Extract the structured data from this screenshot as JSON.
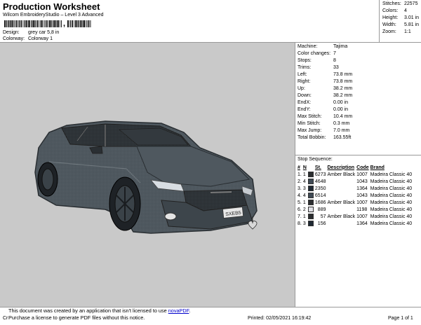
{
  "header": {
    "title": "Production Worksheet",
    "subtitle": "Wilcom EmbroideryStudio – Level 3 Advanced",
    "barcode_suffix": ","
  },
  "meta": [
    {
      "label": "Design:",
      "value": "grey car 5,8 in"
    },
    {
      "label": "Colorway:",
      "value": "Colorway 1"
    }
  ],
  "summary": [
    {
      "label": "Stitches:",
      "value": "22575"
    },
    {
      "label": "Colors:",
      "value": "4"
    },
    {
      "label": "Height:",
      "value": "3.01 in"
    },
    {
      "label": "Width:",
      "value": "5.81 in"
    },
    {
      "label": "Zoom:",
      "value": "1:1"
    }
  ],
  "stats": [
    {
      "label": "Machine:",
      "value": "Tajima"
    },
    {
      "label": "Color changes:",
      "value": "7"
    },
    {
      "label": "Stops:",
      "value": "8"
    },
    {
      "label": "Trims:",
      "value": "33"
    },
    {
      "label": "Left:",
      "value": "73.8 mm"
    },
    {
      "label": "Right:",
      "value": "73.8 mm"
    },
    {
      "label": "Up:",
      "value": "38.2 mm"
    },
    {
      "label": "Down:",
      "value": "38.2 mm"
    },
    {
      "label": "EndX:",
      "value": "0.00 in"
    },
    {
      "label": "EndY:",
      "value": "0.00 in"
    },
    {
      "label": "Max Stitch:",
      "value": "10.4 mm"
    },
    {
      "label": "Min Stitch:",
      "value": "0.3 mm"
    },
    {
      "label": "Max Jump:",
      "value": "7.0 mm"
    },
    {
      "label": "Total Bobbin:",
      "value": "163.55ft"
    }
  ],
  "sequence": {
    "title": "Stop Sequence:",
    "columns": [
      "#",
      "N",
      "",
      "St.",
      "Description",
      "Code",
      "Brand"
    ],
    "rows": [
      {
        "num": "1.",
        "n": "1",
        "color": "#2b2e30",
        "st": "6273",
        "desc": "Amber Black",
        "code": "1007",
        "brand": "Madeira Classic 40"
      },
      {
        "num": "2.",
        "n": "4",
        "color": "#3f4a55",
        "st": "4648",
        "desc": "",
        "code": "1043",
        "brand": "Madeira Classic 40"
      },
      {
        "num": "3.",
        "n": "3",
        "color": "#1f2933",
        "st": "2350",
        "desc": "",
        "code": "1364",
        "brand": "Madeira Classic 40"
      },
      {
        "num": "4.",
        "n": "4",
        "color": "#3f4a55",
        "st": "6514",
        "desc": "",
        "code": "1043",
        "brand": "Madeira Classic 40"
      },
      {
        "num": "5.",
        "n": "1",
        "color": "#2b2e30",
        "st": "1686",
        "desc": "Amber Black",
        "code": "1007",
        "brand": "Madeira Classic 40"
      },
      {
        "num": "6.",
        "n": "2",
        "color": "#e0e0e6",
        "st": "889",
        "desc": "",
        "code": "1198",
        "brand": "Madeira Classic 40"
      },
      {
        "num": "7.",
        "n": "1",
        "color": "#2b2e30",
        "st": "57",
        "desc": "Amber Black",
        "code": "1007",
        "brand": "Madeira Classic 40"
      },
      {
        "num": "8.",
        "n": "3",
        "color": "#1f2933",
        "st": "156",
        "desc": "",
        "code": "1364",
        "brand": "Madeira Classic 40"
      }
    ]
  },
  "design": {
    "plate_text": "SXEB5"
  },
  "footer": {
    "notice_prefix": "This document was created by an application that isn't licensed to use ",
    "notice_link": "novaPDF",
    "notice_suffix": ".",
    "notice_line2": "Purchase a license to generate PDF files without this notice.",
    "cr": "Cr",
    "printed": "Printed:  02/05/2021 16:19:42",
    "page": "Page 1 of 1"
  }
}
